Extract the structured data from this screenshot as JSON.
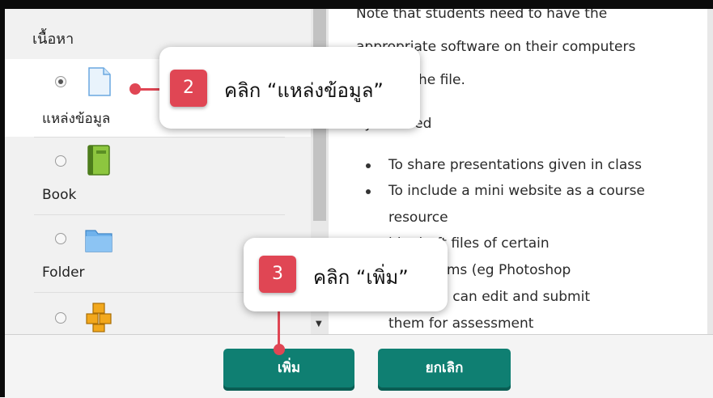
{
  "chooser": {
    "section_title": "เนื้อหา",
    "modules": [
      {
        "label": "แหล่งข้อมูล",
        "icon": "document-icon",
        "selected": true
      },
      {
        "label": "Book",
        "icon": "book-icon",
        "selected": false
      },
      {
        "label": "Folder",
        "icon": "folder-icon",
        "selected": false
      },
      {
        "label": "",
        "icon": "package-icon",
        "selected": false
      }
    ]
  },
  "description": {
    "lines": [
      "Note that students need to have the",
      "appropriate software on their computers",
      "to open the file.",
      "ay be used"
    ],
    "bullets": [
      "To share presentations given in class",
      "To include a mini website as a course",
      "resource",
      "ide draft files of certain",
      "e programs (eg Photoshop",
      "students can edit and submit",
      "them for assessment"
    ]
  },
  "footer": {
    "add_label": "เพิ่ม",
    "cancel_label": "ยกเลิก"
  },
  "callouts": [
    {
      "number": "2",
      "text": "คลิก “แหล่งข้อมูล”"
    },
    {
      "number": "3",
      "text": "คลิก “เพิ่ม”"
    }
  ],
  "colors": {
    "accent_button": "#0f7f72",
    "callout_badge": "#e04654"
  }
}
